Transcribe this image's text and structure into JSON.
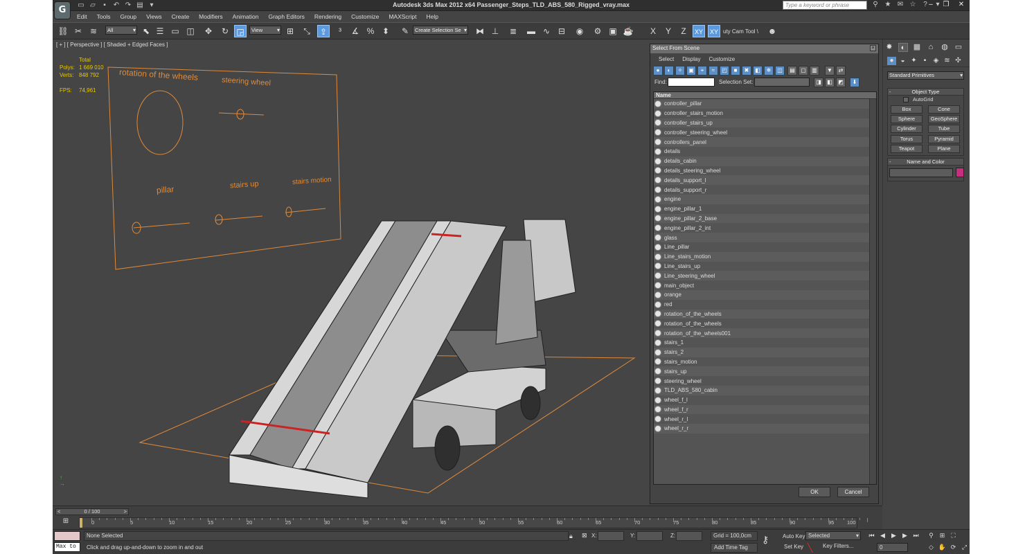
{
  "window": {
    "title": "Autodesk 3ds Max  2012 x64     Passenger_Steps_TLD_ABS_580_Rigged_vray.max",
    "search_placeholder": "Type a keyword or phrase"
  },
  "menu": [
    "Edit",
    "Tools",
    "Group",
    "Views",
    "Create",
    "Modifiers",
    "Animation",
    "Graph Editors",
    "Rendering",
    "Customize",
    "MAXScript",
    "Help"
  ],
  "toolbar": {
    "filter_value": "All",
    "refcoord_value": "View",
    "named_selection": "Create Selection Se",
    "axis_buttons": [
      "X",
      "Y",
      "Z",
      "XY",
      "XY"
    ],
    "cam_tool_label": "uty Cam Tool \\"
  },
  "viewport": {
    "label": "[ + ] [ Perspective ] [ Shaded + Edged Faces ]",
    "stats": {
      "header": "Total",
      "polys_label": "Polys:",
      "polys_value": "1 669 010",
      "verts_label": "Verts:",
      "verts_value": "848 792",
      "fps_label": "FPS:",
      "fps_value": "74,961"
    },
    "panel_labels": {
      "rotation": "rotation of the wheels",
      "steering": "steering wheel",
      "pillar": "pillar",
      "stairs_up": "stairs up",
      "stairs_motion": "stairs motion"
    }
  },
  "select_from_scene": {
    "title": "Select From Scene",
    "menu": [
      "Select",
      "Display",
      "Customize"
    ],
    "find_label": "Find:",
    "selection_set_label": "Selection Set:",
    "column_name": "Name",
    "items": [
      "controller_pillar",
      "controller_stairs_motion",
      "controller_stairs_up",
      "controller_steering_wheel",
      "controllers_panel",
      "details",
      "details_cabin",
      "details_steering_wheel",
      "details_support_l",
      "details_support_r",
      "engine",
      "engine_pillar_1",
      "engine_pillar_2_base",
      "engine_pillar_2_int",
      "glass",
      "Line_pillar",
      "Line_stairs_motion",
      "Line_stairs_up",
      "Line_steering_wheel",
      "main_object",
      "orange",
      "red",
      "rotation_of_the_wheels",
      "rotation_of_the_wheels",
      "rotation_of_the_wheels001",
      "stairs_1",
      "stairs_2",
      "stairs_motion",
      "stairs_up",
      "steering_wheel",
      "TLD_ABS_580_cabin",
      "wheel_f_l",
      "wheel_f_r",
      "wheel_r_l",
      "wheel_r_r"
    ],
    "ok_label": "OK",
    "cancel_label": "Cancel"
  },
  "command_panel": {
    "category": "Standard Primitives",
    "object_type_title": "Object Type",
    "autogrid_label": "AutoGrid",
    "buttons": [
      "Box",
      "Cone",
      "Sphere",
      "GeoSphere",
      "Cylinder",
      "Tube",
      "Torus",
      "Pyramid",
      "Teapot",
      "Plane"
    ],
    "name_color_title": "Name and Color",
    "object_color": "#c72e7d"
  },
  "timeline": {
    "slider_label": "0 / 100",
    "ticks": [
      "0",
      "5",
      "10",
      "15",
      "20",
      "25",
      "30",
      "35",
      "40",
      "45",
      "50",
      "55",
      "60",
      "65",
      "70",
      "75",
      "80",
      "85",
      "90",
      "95",
      "100"
    ]
  },
  "status": {
    "maxscript_text": "Max to",
    "selection": "None Selected",
    "prompt": "Click and drag up-and-down to zoom in and out",
    "x_label": "X:",
    "y_label": "Y:",
    "z_label": "Z:",
    "grid": "Grid = 100,0cm",
    "add_time_tag": "Add Time Tag",
    "auto_key": "Auto Key",
    "set_key": "Set Key",
    "selected_value": "Selected",
    "key_filters": "Key Filters...",
    "current_frame": "0"
  }
}
